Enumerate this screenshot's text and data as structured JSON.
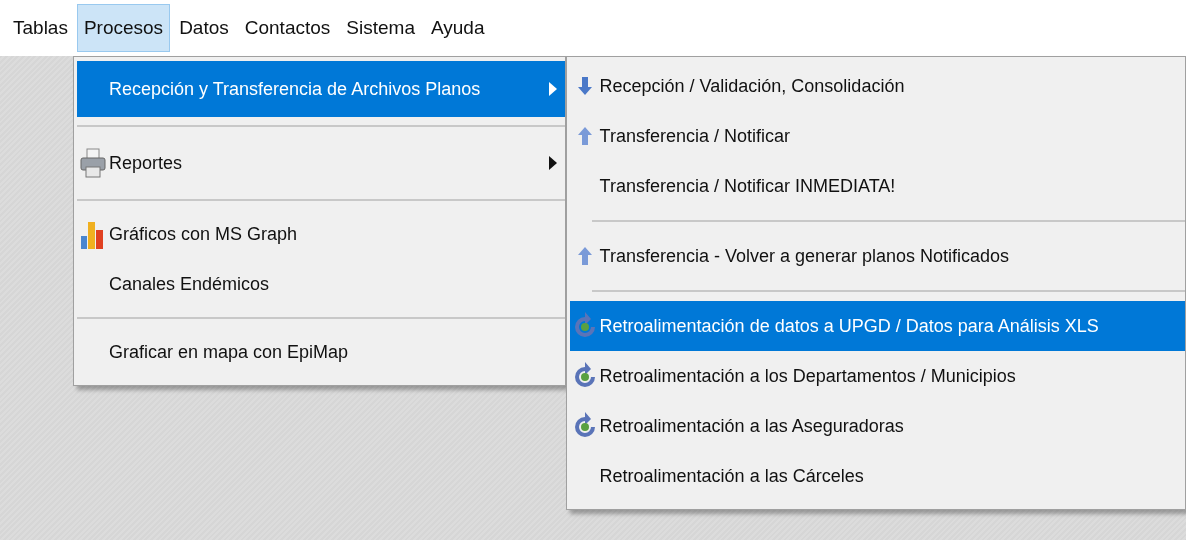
{
  "menubar": [
    {
      "label": "Tablas",
      "selected": false
    },
    {
      "label": "Procesos",
      "selected": true
    },
    {
      "label": "Datos",
      "selected": false
    },
    {
      "label": "Contactos",
      "selected": false
    },
    {
      "label": "Sistema",
      "selected": false
    },
    {
      "label": "Ayuda",
      "selected": false
    }
  ],
  "menu": {
    "items": [
      {
        "kind": "item",
        "label": "Recepción y Transferencia de Archivos Planos",
        "selected": true,
        "submenu": true
      },
      {
        "kind": "separator"
      },
      {
        "kind": "item",
        "label": "Reportes",
        "selected": false,
        "submenu": true
      },
      {
        "kind": "separator"
      },
      {
        "kind": "item",
        "label": "Gráficos con MS Graph",
        "selected": false,
        "submenu": false
      },
      {
        "kind": "item",
        "label": "Canales Endémicos",
        "selected": false,
        "submenu": false
      },
      {
        "kind": "separator"
      },
      {
        "kind": "item",
        "label": "Graficar en mapa con EpiMap",
        "selected": false,
        "submenu": false
      }
    ]
  },
  "submenu": {
    "items": [
      {
        "kind": "item",
        "label": "Recepción / Validación, Consolidación",
        "selected": false
      },
      {
        "kind": "item",
        "label": "Transferencia / Notificar",
        "selected": false
      },
      {
        "kind": "item",
        "label": "Transferencia / Notificar INMEDIATA!",
        "selected": false
      },
      {
        "kind": "separator"
      },
      {
        "kind": "item",
        "label": "Transferencia - Volver a generar planos Notificados",
        "selected": false
      },
      {
        "kind": "separator"
      },
      {
        "kind": "item",
        "label": "Retroalimentación de datos a UPGD / Datos para Análisis XLS",
        "selected": true
      },
      {
        "kind": "item",
        "label": "Retroalimentación a los Departamentos / Municipios",
        "selected": false
      },
      {
        "kind": "item",
        "label": "Retroalimentación a las Aseguradoras",
        "selected": false
      },
      {
        "kind": "item",
        "label": "Retroalimentación a las Cárceles",
        "selected": false
      }
    ]
  }
}
